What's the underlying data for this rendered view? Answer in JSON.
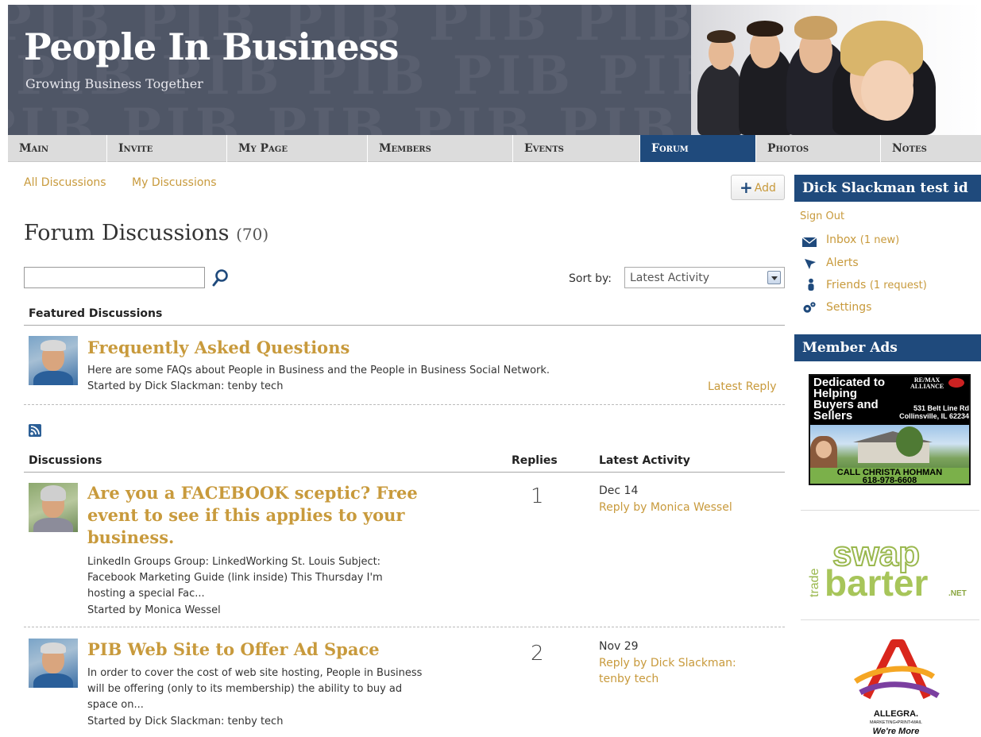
{
  "site": {
    "title": "People In Business",
    "tagline": "Growing Business Together",
    "watermark": "PIB PIB PIB PIB PIB PIB PIB PIB"
  },
  "nav": {
    "tabs": [
      {
        "label": "Main",
        "active": false
      },
      {
        "label": "Invite",
        "active": false
      },
      {
        "label": "My Page",
        "active": false
      },
      {
        "label": "Members",
        "active": false
      },
      {
        "label": "Events",
        "active": false
      },
      {
        "label": "Forum",
        "active": true
      },
      {
        "label": "Photos",
        "active": false
      },
      {
        "label": "Notes",
        "active": false
      }
    ]
  },
  "subnav": {
    "all": "All Discussions",
    "mine": "My Discussions",
    "add": "Add"
  },
  "page": {
    "title": "Forum Discussions",
    "count": "(70)",
    "sort_label": "Sort by:",
    "sort_value": "Latest Activity"
  },
  "featured": {
    "heading": "Featured Discussions",
    "item": {
      "title": "Frequently Asked Questions",
      "excerpt": "Here are some FAQs about People in Business and the People in Business Social Network.",
      "started_by": "Started by Dick Slackman: tenby tech",
      "latest_reply": "Latest Reply"
    }
  },
  "discussions": {
    "heading": "Discussions",
    "replies_heading": "Replies",
    "latest_heading": "Latest Activity",
    "items": [
      {
        "title_lines": [
          "Are you a FACEBOOK sceptic? Free",
          "event to see if this applies to your",
          "business."
        ],
        "excerpt_lines": [
          "LinkedIn Groups Group: LinkedWorking St. Louis Subject:",
          "Facebook Marketing Guide (link inside) This Thursday I'm",
          "hosting a special Fac..."
        ],
        "started_by": "Started by Monica Wessel",
        "replies": "1",
        "date": "Dec 14",
        "reply_by": [
          "Reply by Monica Wessel"
        ]
      },
      {
        "title_lines": [
          "PIB Web Site to Offer Ad Space"
        ],
        "excerpt_lines": [
          "In order to cover the cost of web site hosting, People in Business",
          "will be offering (only to its membership) the ability to buy ad",
          "space on..."
        ],
        "started_by": "Started by Dick Slackman: tenby tech",
        "replies": "2",
        "date": "Nov 29",
        "reply_by": [
          "Reply by Dick Slackman:",
          "tenby tech"
        ]
      }
    ]
  },
  "sidebar": {
    "user_name": "Dick Slackman test id",
    "sign_out": "Sign Out",
    "inbox": "Inbox",
    "inbox_note": "(1 new)",
    "alerts": "Alerts",
    "friends": "Friends",
    "friends_note": "(1 request)",
    "settings": "Settings",
    "ads_heading": "Member Ads",
    "ad1": {
      "line1": "Dedicated to",
      "line2": "Helping",
      "line3": "Buyers and",
      "line4": "Sellers",
      "brand1": "RE/MAX",
      "brand2": "ALLIANCE",
      "addr1": "531 Belt Line Rd",
      "addr2": "Collinsville, IL 62234",
      "call": "CALL CHRISTA HOHMAN",
      "phone": "618-978-6608"
    },
    "ad2": {
      "trade": "trade",
      "swap": "swap",
      "barter": "barter",
      "net": ".NET"
    },
    "ad3": {
      "name": "ALLEGRA.",
      "sub": "MARKETING•PRINT•MAIL",
      "slogan": "We're More"
    }
  },
  "colors": {
    "link": "#c89a3c",
    "brand_blue": "#1f4a7c",
    "header_bg": "#4f5666",
    "nav_bg": "#dcdcdc"
  }
}
